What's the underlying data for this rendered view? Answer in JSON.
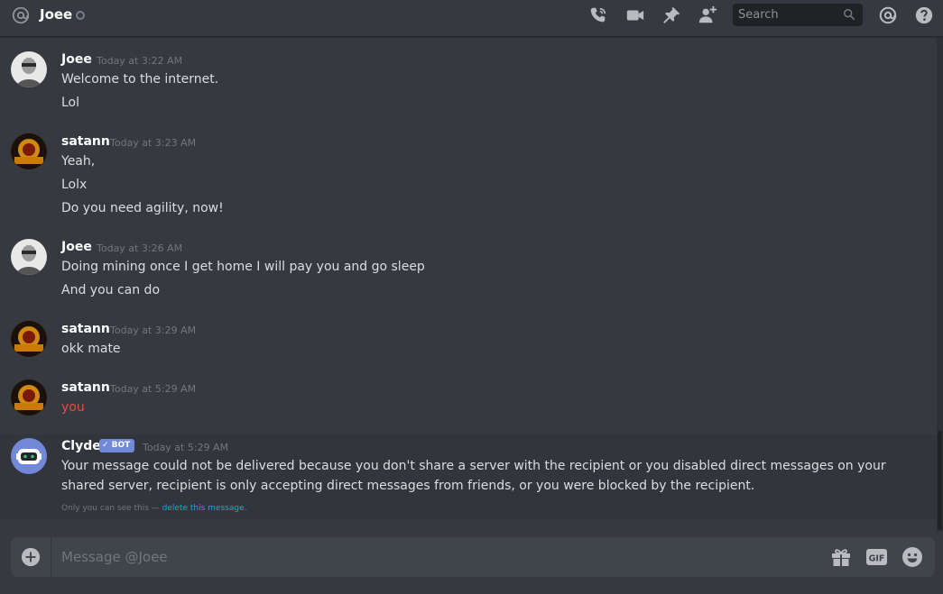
{
  "header": {
    "channel_name": "Joee",
    "search_placeholder": "Search"
  },
  "messages": [
    {
      "author": "Joee",
      "timestamp": "Today at 3:22 AM",
      "lines": [
        "Welcome to the internet.",
        "Lol"
      ]
    },
    {
      "author": "satann",
      "timestamp": "Today at 3:23 AM",
      "lines": [
        "Yeah,",
        "Lolx",
        "Do you need agility, now!"
      ]
    },
    {
      "author": "Joee",
      "timestamp": "Today at 3:26 AM",
      "lines": [
        "Doing mining once I get home I will pay you and go sleep",
        "And you can do"
      ]
    },
    {
      "author": "satann",
      "timestamp": "Today at 3:29 AM",
      "lines": [
        "okk mate"
      ]
    },
    {
      "author": "satann",
      "timestamp": "Today at 5:29 AM",
      "lines": [
        "you"
      ],
      "failed_color": "#f04747"
    }
  ],
  "clyde": {
    "author": "Clyde",
    "badge": "✓ BOT",
    "timestamp": "Today at 5:29 AM",
    "text": "Your message could not be delivered because you don't share a server with the recipient or you disabled direct messages on your shared server, recipient is only accepting direct messages from friends, or you were blocked by the recipient.",
    "ephemeral_note": "Only you can see this — ",
    "delete_link": "delete this message."
  },
  "composer": {
    "placeholder": "Message @Joee",
    "gif_label": "GIF"
  },
  "icons": {
    "header": [
      "at-icon",
      "phone-call-icon",
      "video-icon",
      "pin-icon",
      "add-friend-icon",
      "search-icon",
      "mention-icon",
      "help-icon"
    ],
    "composer": [
      "add-attachment-icon",
      "gift-icon",
      "gif-icon",
      "emoji-icon"
    ]
  },
  "colors": {
    "background": "#36393f",
    "accent": "#7289da",
    "error": "#f04747",
    "link": "#00b0f4"
  }
}
